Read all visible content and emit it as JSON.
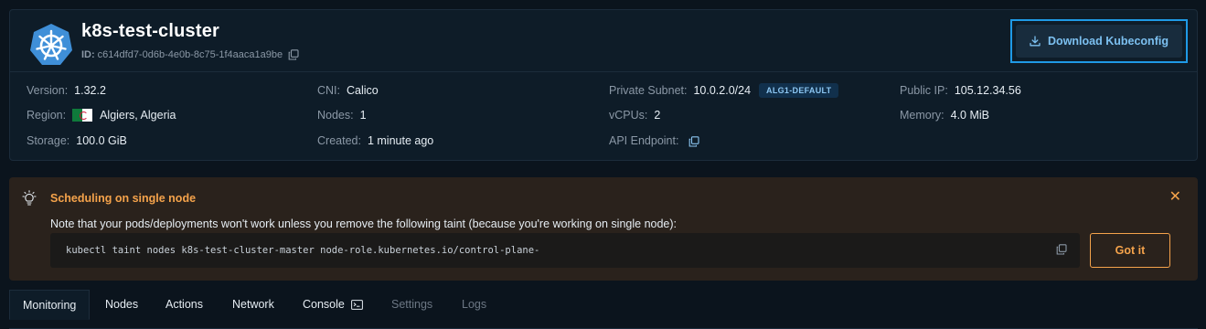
{
  "cluster": {
    "name": "k8s-test-cluster",
    "id_label": "ID:",
    "id_value": "c614dfd7-0d6b-4e0b-8c75-1f4aaca1a9be",
    "download_button": "Download Kubeconfig"
  },
  "info": {
    "version": {
      "label": "Version:",
      "value": "1.32.2"
    },
    "cni": {
      "label": "CNI:",
      "value": "Calico"
    },
    "private_subnet": {
      "label": "Private Subnet:",
      "value": "10.0.2.0/24",
      "badge": "ALG1-DEFAULT"
    },
    "public_ip": {
      "label": "Public IP:",
      "value": "105.12.34.56"
    },
    "region": {
      "label": "Region:",
      "value": "Algiers, Algeria"
    },
    "nodes": {
      "label": "Nodes:",
      "value": "1"
    },
    "vcpus": {
      "label": "vCPUs:",
      "value": "2"
    },
    "memory": {
      "label": "Memory:",
      "value": "4.0 MiB"
    },
    "storage": {
      "label": "Storage:",
      "value": "100.0 GiB"
    },
    "created": {
      "label": "Created:",
      "value": "1 minute ago"
    },
    "api_endpoint": {
      "label": "API Endpoint:"
    }
  },
  "alert": {
    "title": "Scheduling on single node",
    "message": "Note that your pods/deployments won't work unless you remove the following taint (because you're working on single node):",
    "command": "kubectl taint nodes k8s-test-cluster-master node-role.kubernetes.io/control-plane-",
    "confirm_button": "Got it",
    "accent_color": "#f5a34b"
  },
  "tabs": [
    {
      "label": "Monitoring",
      "state": "active"
    },
    {
      "label": "Nodes",
      "state": "normal"
    },
    {
      "label": "Actions",
      "state": "normal"
    },
    {
      "label": "Network",
      "state": "normal"
    },
    {
      "label": "Console",
      "state": "normal",
      "icon": "terminal-icon"
    },
    {
      "label": "Settings",
      "state": "disabled"
    },
    {
      "label": "Logs",
      "state": "disabled"
    }
  ],
  "colors": {
    "background": "#0b141d",
    "card": "#0e1c28",
    "primary_link": "#7cc0f0",
    "focus_outline": "#1f9ae6"
  }
}
